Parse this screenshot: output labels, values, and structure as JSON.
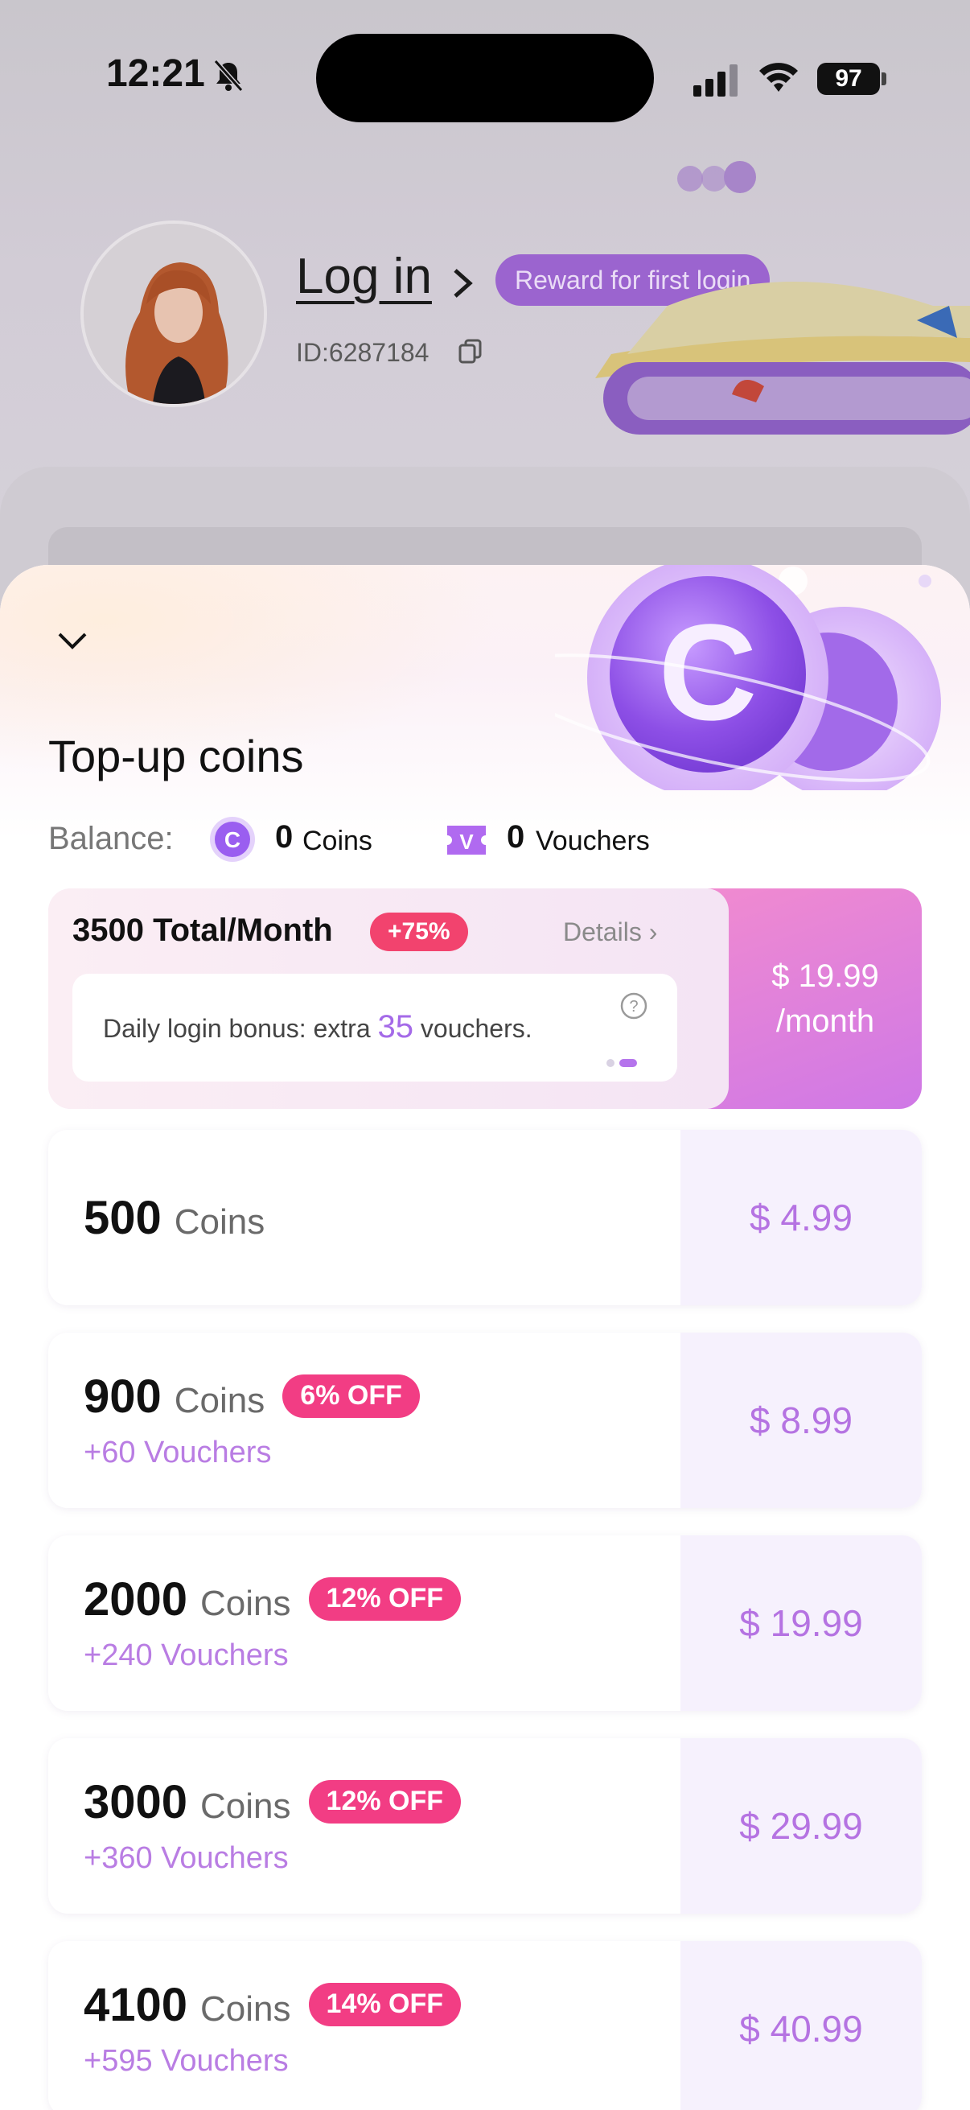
{
  "status_bar": {
    "time": "12:21",
    "battery": "97"
  },
  "profile": {
    "login_label": "Log in",
    "reward_badge": "Reward for first login",
    "user_id": "ID:6287184"
  },
  "sheet": {
    "title": "Top-up coins",
    "balance_label": "Balance:",
    "coins_value": "0",
    "coins_unit": "Coins",
    "vouchers_value": "0",
    "vouchers_unit": "Vouchers"
  },
  "subscription": {
    "title": "3500 Total/Month",
    "badge": "+75%",
    "details": "Details",
    "bonus_prefix": "Daily login bonus: extra ",
    "bonus_number": "35",
    "bonus_suffix": " vouchers.",
    "price": "$ 19.99",
    "period": "/month"
  },
  "packages": [
    {
      "amount": "500",
      "unit": "Coins",
      "badge": "",
      "vouchers": "",
      "price": "$ 4.99"
    },
    {
      "amount": "900",
      "unit": "Coins",
      "badge": "6% OFF",
      "vouchers": "+60 Vouchers",
      "price": "$ 8.99"
    },
    {
      "amount": "2000",
      "unit": "Coins",
      "badge": "12% OFF",
      "vouchers": "+240 Vouchers",
      "price": "$ 19.99"
    },
    {
      "amount": "3000",
      "unit": "Coins",
      "badge": "12% OFF",
      "vouchers": "+360 Vouchers",
      "price": "$ 29.99"
    },
    {
      "amount": "4100",
      "unit": "Coins",
      "badge": "14% OFF",
      "vouchers": "+595 Vouchers",
      "price": "$ 40.99"
    }
  ],
  "colors": {
    "accent_purple": "#b573e2",
    "badge_pink": "#f23d84",
    "subscription_gradient": "#f08ad0"
  }
}
